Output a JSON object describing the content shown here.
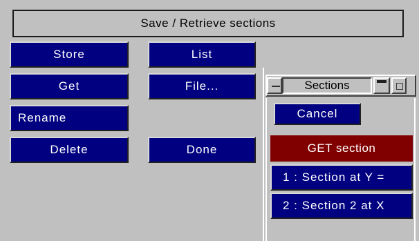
{
  "panel": {
    "title": "Save / Retrieve sections"
  },
  "buttons": {
    "store": "Store",
    "list": "List",
    "get": "Get",
    "file": "File...",
    "rename": "Rename",
    "delete": "Delete",
    "done": "Done"
  },
  "sections_window": {
    "title": "Sections",
    "cancel": "Cancel",
    "mode_header": "GET section",
    "items": [
      "1 : Section at  Y =",
      "2 : Section 2 at X"
    ]
  },
  "colors": {
    "background": "#c0c0c0",
    "button_blue": "#000080",
    "header_red": "#800000",
    "text_light": "#ffffff"
  }
}
